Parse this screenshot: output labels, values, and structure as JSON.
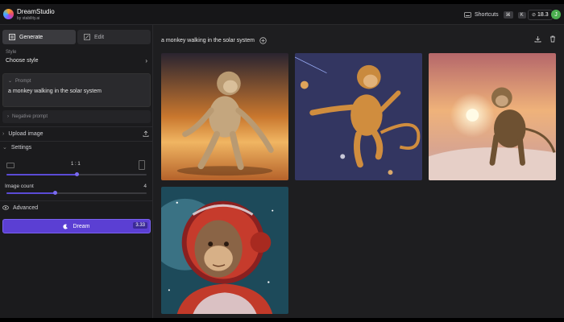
{
  "header": {
    "app_name": "DreamStudio",
    "app_sub": "by stability.ai",
    "shortcuts_label": "Shortcuts",
    "shortcut_keys": [
      "⌘",
      "K"
    ],
    "credits": "18.3",
    "avatar_initial": "J"
  },
  "sidebar": {
    "tabs": [
      {
        "label": "Generate"
      },
      {
        "label": "Edit"
      }
    ],
    "style_label": "Style",
    "style_value": "Choose style",
    "prompt_label": "Prompt",
    "prompt_text": "a monkey walking in the solar system",
    "negative_prompt_label": "Negative prompt",
    "upload_label": "Upload image",
    "settings_label": "Settings",
    "aspect_ratio_value": "1 : 1",
    "aspect_ratio_level": 0.5,
    "image_count_label": "Image count",
    "image_count_value": "4",
    "image_count_level": 0.35,
    "advanced_label": "Advanced",
    "dream_label": "Dream",
    "dream_cost": "3.33"
  },
  "main": {
    "prompt_title": "a monkey walking in the solar system",
    "images": [
      {
        "name": "monkey-desert-sunset"
      },
      {
        "name": "monkey-space-planets"
      },
      {
        "name": "monkey-dunes-sun"
      },
      {
        "name": "monkey-astronaut-helmet"
      }
    ]
  },
  "colors": {
    "accent": "#5b3fd3",
    "avatar": "#4caf50"
  },
  "icons": [
    "logo-icon",
    "keyboard-icon",
    "credits-icon",
    "generate-icon",
    "edit-icon",
    "chevron-right-icon",
    "chevron-down-icon",
    "upload-icon",
    "eye-icon",
    "dream-icon",
    "add-circle-icon",
    "download-icon",
    "trash-icon"
  ]
}
